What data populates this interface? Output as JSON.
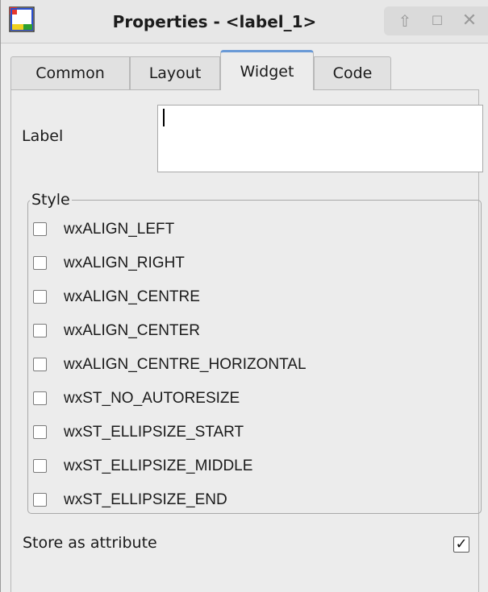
{
  "window": {
    "title": "Properties - <label_1>",
    "controls": {
      "up_glyph": "⇧",
      "maximize_glyph": "☐",
      "close_glyph": "✕"
    }
  },
  "tabs": [
    {
      "label": "Common",
      "active": false
    },
    {
      "label": "Layout",
      "active": false
    },
    {
      "label": "Widget",
      "active": true
    },
    {
      "label": "Code",
      "active": false
    }
  ],
  "widget": {
    "label_caption": "Label",
    "label_value": "",
    "style_group_title": "Style",
    "style_options": [
      {
        "label": "wxALIGN_LEFT",
        "checked": false
      },
      {
        "label": "wxALIGN_RIGHT",
        "checked": false
      },
      {
        "label": "wxALIGN_CENTRE",
        "checked": false
      },
      {
        "label": "wxALIGN_CENTER",
        "checked": false
      },
      {
        "label": "wxALIGN_CENTRE_HORIZONTAL",
        "checked": false
      },
      {
        "label": "wxST_NO_AUTORESIZE",
        "checked": false
      },
      {
        "label": "wxST_ELLIPSIZE_START",
        "checked": false
      },
      {
        "label": "wxST_ELLIPSIZE_MIDDLE",
        "checked": false
      },
      {
        "label": "wxST_ELLIPSIZE_END",
        "checked": false
      }
    ],
    "store_as_attribute_label": "Store as attribute",
    "store_as_attribute_checked": true,
    "check_glyph": "✓"
  },
  "colors": {
    "active_tab_accent": "#6a9ad6",
    "app_icon_red": "#e8382c",
    "app_icon_blue": "#2a4fd0",
    "app_icon_yellow": "#f0d020",
    "app_icon_green": "#2fa02f"
  }
}
